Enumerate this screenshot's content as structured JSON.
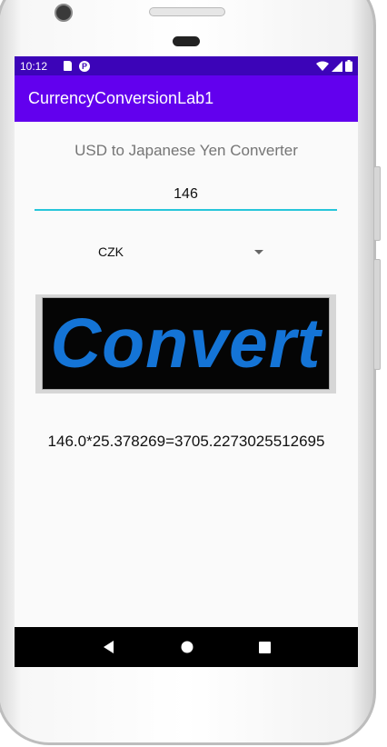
{
  "status_bar": {
    "time": "10:12",
    "p_badge": "P"
  },
  "app_bar": {
    "title": "CurrencyConversionLab1"
  },
  "main": {
    "heading": "USD to Japanese Yen Converter",
    "amount_value": "146",
    "currency_selected": "CZK",
    "convert_label": "Convert",
    "result_text": "146.0*25.378269=3705.2273025512695"
  },
  "colors": {
    "status_bar": "#3c04b8",
    "app_bar": "#6200ee",
    "input_underline": "#26c6da",
    "convert_text": "#1474d6"
  },
  "icons": {
    "status_left": [
      "sd-card-icon",
      "play-protect-icon"
    ],
    "status_right": [
      "wifi-icon",
      "signal-icon",
      "battery-icon"
    ],
    "nav": [
      "back-icon",
      "home-icon",
      "recents-icon"
    ]
  }
}
